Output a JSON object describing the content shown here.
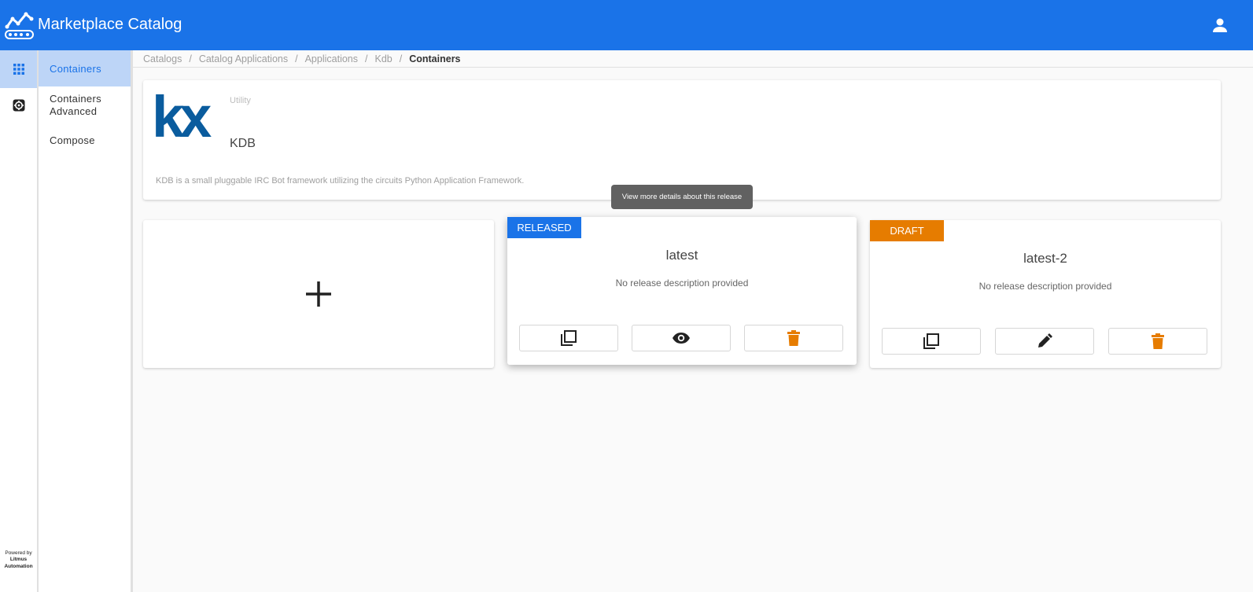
{
  "header": {
    "title": "Marketplace Catalog",
    "brand_color": "#1a73e8",
    "logo_icon": "conveyor-chart-icon",
    "user_icon": "account-icon"
  },
  "rail": {
    "items": [
      {
        "icon": "apps-grid-icon",
        "active": true
      },
      {
        "icon": "settings-cog-icon",
        "active": false
      }
    ],
    "powered_by": {
      "label": "Powered by",
      "brand_line1": "Litmus",
      "brand_line2": "Automation"
    }
  },
  "subnav": {
    "items": [
      {
        "label": "Containers",
        "active": true
      },
      {
        "label": "Containers Advanced",
        "active": false
      },
      {
        "label": "Compose",
        "active": false
      }
    ]
  },
  "breadcrumb": {
    "items": [
      "Catalogs",
      "Catalog Applications",
      "Applications",
      "Kdb"
    ],
    "current": "Containers",
    "separator": "/"
  },
  "app": {
    "logo_text": "kx",
    "category": "Utility",
    "name": "KDB",
    "description": "KDB is a small pluggable IRC Bot framework utilizing the circuits Python Application Framework."
  },
  "tooltip": {
    "text": "View more details about this release"
  },
  "releases": [
    {
      "status": "RELEASED",
      "status_color": "#1a73e8",
      "title": "latest",
      "description": "No release description provided",
      "actions": [
        "copy-icon",
        "view-eye-icon",
        "delete-trash-icon"
      ]
    },
    {
      "status": "DRAFT",
      "status_color": "#e67c00",
      "title": "latest-2",
      "description": "No release description provided",
      "actions": [
        "copy-icon",
        "edit-pencil-icon",
        "delete-trash-icon"
      ]
    }
  ],
  "add_card": {
    "icon": "plus-icon"
  }
}
